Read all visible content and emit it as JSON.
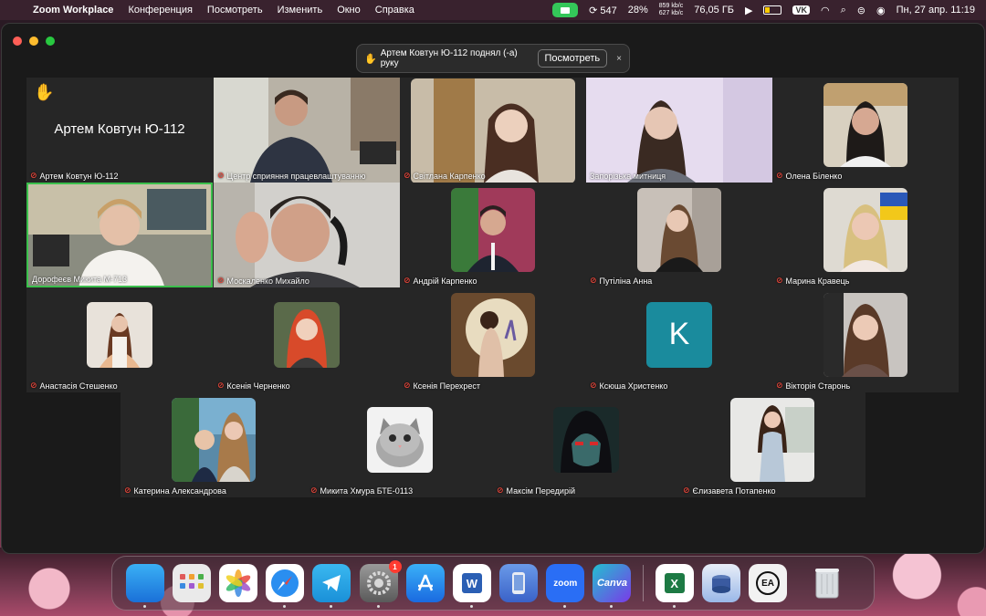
{
  "menubar": {
    "app_name": "Zoom Workplace",
    "menus": [
      "Конференция",
      "Посмотреть",
      "Изменить",
      "Окно",
      "Справка"
    ],
    "sync_count": "547",
    "cpu": "28%",
    "net_up": "859 kb/c",
    "net_down": "627 kb/c",
    "disk": "76,05 ГБ",
    "vk": "VK",
    "datetime": "Пн, 27 апр.  11:19"
  },
  "banner": {
    "message": "Артем Ковтун Ю-112 поднял (-а) руку",
    "view_label": "Посмотреть",
    "close_label": "×"
  },
  "featured": {
    "name": "Артем Ковтун Ю-112"
  },
  "participants": [
    {
      "name": "Артем Ковтун Ю-112",
      "muted": true
    },
    {
      "name": "Центр сприяння працевлаштуванню",
      "muted": true
    },
    {
      "name": "Світлана Карпенко",
      "muted": true
    },
    {
      "name": "Запорізька митниця",
      "muted": false
    },
    {
      "name": "Олена Біленко",
      "muted": true
    },
    {
      "name": "Дорофеєв Микита М-713",
      "muted": false
    },
    {
      "name": "Москаленко Михайло",
      "muted": true
    },
    {
      "name": "Андрій Карпенко",
      "muted": true
    },
    {
      "name": "Путіліна Анна",
      "muted": true
    },
    {
      "name": "Марина Кравець",
      "muted": true
    },
    {
      "name": "Анастасія Стешенко",
      "muted": true
    },
    {
      "name": "Ксенія Черненко",
      "muted": true
    },
    {
      "name": "Ксенія Перехрест",
      "muted": true
    },
    {
      "name": "Ксюша Христенко",
      "muted": true,
      "initial": "K"
    },
    {
      "name": "Вікторія Старонь",
      "muted": true
    },
    {
      "name": "Катерина Александрова",
      "muted": true
    },
    {
      "name": "Микита Хмура БТЕ-0113",
      "muted": true
    },
    {
      "name": "Максім Передирій",
      "muted": true
    },
    {
      "name": "Єлизавета Потапенко",
      "muted": true
    }
  ],
  "dock": {
    "settings_badge": "1",
    "zoom_label": "zoom",
    "canva_label": "Canva",
    "word_label": "W",
    "excel_label": "X",
    "ea_label": "EA"
  }
}
